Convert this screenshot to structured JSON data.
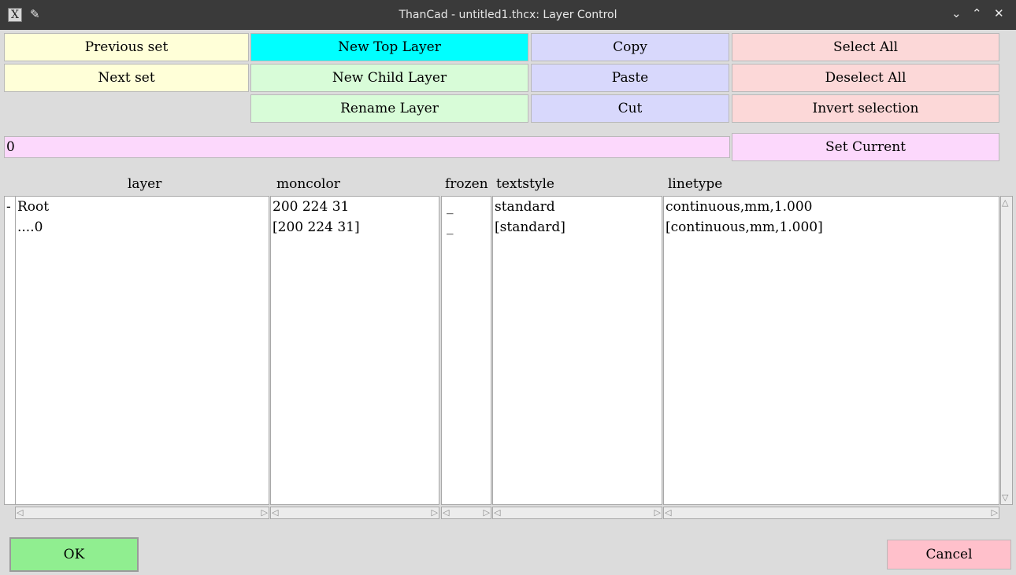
{
  "window": {
    "title": "ThanCad - untitled1.thcx: Layer Control",
    "app_icon": "X",
    "icons": [
      "app-icon",
      "pin-icon",
      "minimize-icon",
      "maximize-icon",
      "close-icon"
    ]
  },
  "buttons": {
    "previous_set": "Previous set",
    "next_set": "Next set",
    "new_top_layer": "New Top Layer",
    "new_child_layer": "New Child Layer",
    "rename_layer": "Rename Layer",
    "copy": "Copy",
    "paste": "Paste",
    "cut": "Cut",
    "select_all": "Select All",
    "deselect_all": "Deselect All",
    "invert_selection": "Invert selection",
    "set_current": "Set Current",
    "ok": "OK",
    "cancel": "Cancel"
  },
  "current_layer": {
    "value": "0"
  },
  "table": {
    "headers": {
      "layer": "layer",
      "moncolor": "moncolor",
      "frozen": "frozen",
      "textstyle": "textstyle",
      "linetype": "linetype"
    },
    "rows": [
      {
        "expander": "-",
        "layer": "Root",
        "moncolor": "200 224 31",
        "frozen": "_",
        "textstyle": "standard",
        "linetype": "continuous,mm,1.000"
      },
      {
        "expander": "",
        "layer": "....0",
        "moncolor": "[200 224 31]",
        "frozen": "_",
        "textstyle": "[standard]",
        "linetype": "[continuous,mm,1.000]"
      }
    ]
  },
  "colors": {
    "yellow": "#ffffd8",
    "cyan": "#00ffff",
    "green": "#d8fcd8",
    "blue": "#d8d8fc",
    "red": "#fcd8d8",
    "magenta": "#fcd8fc",
    "ok": "#90ee90",
    "cancel": "#ffc0cb"
  }
}
